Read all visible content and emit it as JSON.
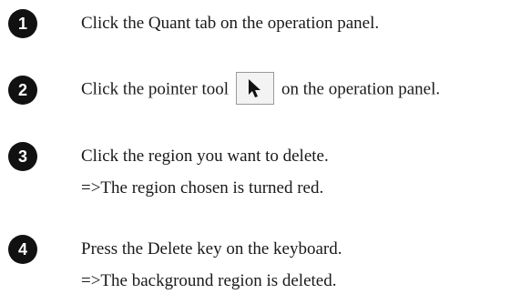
{
  "steps": [
    {
      "number": "1",
      "line1": "Click the Quant tab on the operation panel."
    },
    {
      "number": "2",
      "line1_before": "Click the pointer tool",
      "tool_icon": "pointer-arrow-icon",
      "line1_after": "on the operation panel."
    },
    {
      "number": "3",
      "line1": "Click the region you want to delete.",
      "line2": "=>The region chosen is turned red."
    },
    {
      "number": "4",
      "line1": "Press the Delete key on the keyboard.",
      "line2": "=>The background region is deleted."
    }
  ]
}
